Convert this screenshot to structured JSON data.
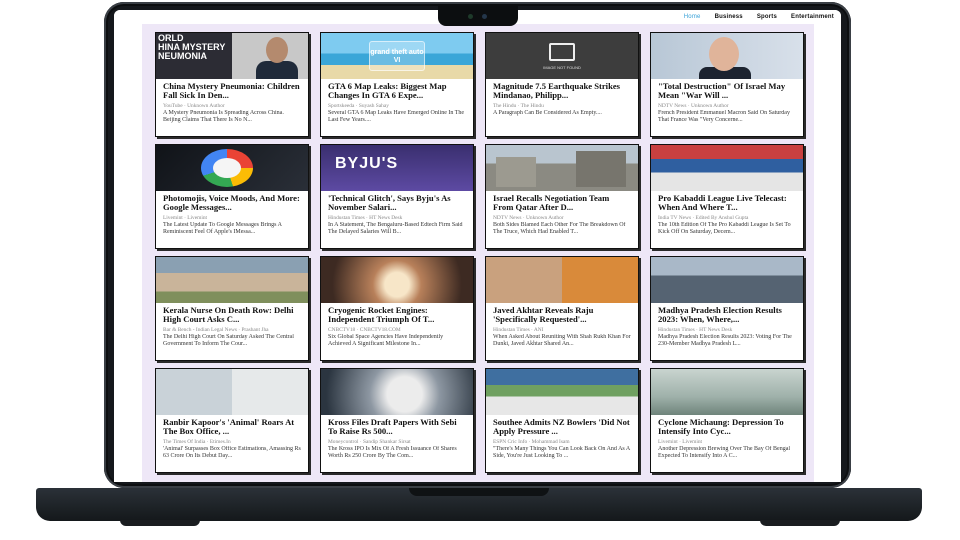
{
  "nav": {
    "items": [
      "Home",
      "Business",
      "Sports",
      "Entertainment"
    ]
  },
  "thumbs": {
    "card1_overlay": "ORLD\nHINA MYSTERY\nNEUMONIA",
    "card2_overlay": "grand theft auto VI",
    "card3_overlay": "IMAGE NOT FOUND",
    "card6_overlay": "BYJU'S"
  },
  "cards": [
    {
      "title": "China Mystery Pneumonia: Children Fall Sick In Den...",
      "meta": "YouTube · Unknown Author",
      "desc": "A Mystery Pneumonia Is Spreading Across China. Beijing Claims That There Is No N..."
    },
    {
      "title": "GTA 6 Map Leaks: Biggest Map Changes In GTA 6 Expe...",
      "meta": "Sportskeeda · Suyash Sahay",
      "desc": "Several GTA 6 Map Leaks Have Emerged Online In The Last Few Years...."
    },
    {
      "title": "Magnitude 7.5 Earthquake Strikes Mindanao, Philipp...",
      "meta": "The Hindu · The Hindu",
      "desc": "A Paragraph Can Be Considered As Empty...."
    },
    {
      "title": "\"Total Destruction\" Of Israel May Mean \"War Will ...",
      "meta": "NDTV News · Unknown Author",
      "desc": "French President Emmanuel Macron Said On Saturday That France Was \"Very Concerne..."
    },
    {
      "title": "Photomojis, Voice Moods, And More: Google Messages...",
      "meta": "Livemint · Livemint",
      "desc": "The Latest Update To Google Messages Brings A Reminiscent Feel Of Apple's IMessa..."
    },
    {
      "title": "'Technical Glitch', Says Byju's As November Salari...",
      "meta": "Hindustan Times · HT News Desk",
      "desc": "In A Statement, The Bengaluru-Based Edtech Firm Said The Delayed Salaries Will B..."
    },
    {
      "title": "Israel Recalls Negotiation Team From Qatar After D...",
      "meta": "NDTV News · Unknown Author",
      "desc": "Both Sides Blamed Each Other For The Breakdown Of The Truce, Which Had Enabled T..."
    },
    {
      "title": "Pro Kabaddi League Live Telecast: When And Where T...",
      "meta": "India TV News · Edited By Anshul Gupta",
      "desc": "The 10th Edition Of The Pro Kabaddi League Is Set To Kick Off On Saturday, Decem..."
    },
    {
      "title": "Kerala Nurse On Death Row: Delhi High Court Asks C...",
      "meta": "Bar & Bench - Indian Legal News · Prashant Jha",
      "desc": "The Delhi High Court On Saturday Asked The Central Government To Inform The Cour..."
    },
    {
      "title": "Cryogenic Rocket Engines: Independent Triumph Of T...",
      "meta": "CNBCTV18 · CNBCTV18.COM",
      "desc": "Six Global Space Agencies Have Independently Achieved A Significant Milestone In..."
    },
    {
      "title": "Javed Akhtar Reveals Raju 'Specifically Requested'...",
      "meta": "Hindustan Times · ANI",
      "desc": "When Asked About Reuniting With Shah Rukh Khan For Dunki, Javed Akhtar Shared An..."
    },
    {
      "title": "Madhya Pradesh Election Results 2023: When, Where,...",
      "meta": "Hindustan Times · HT News Desk",
      "desc": "Madhya Pradesh Election Results 2023: Voting For The 230-Member Madhya Pradesh L..."
    },
    {
      "title": "Ranbir Kapoor's 'Animal' Roars At The Box Office, ...",
      "meta": "The Times Of India · Etimes.In",
      "desc": "'Animal' Surpasses Box Office Estimations, Amassing Rs 63 Crore On Its Debut Day..."
    },
    {
      "title": "Kross Files Draft Papers With Sebi To Raise Rs 500...",
      "meta": "Moneycontrol · Sandip Shankar Sirsat",
      "desc": "The Kross IPO Is Mix Of A Fresh Issuance Of Shares Worth Rs 250 Crore By The Com..."
    },
    {
      "title": "Southee Admits NZ Bowlers 'Did Not Apply Pressure ...",
      "meta": "ESPN Cric Info · Mohammad Isam",
      "desc": "\"There's Many Things You Can Look Back On And As A Side, You're Just Looking To ..."
    },
    {
      "title": "Cyclone Michaung: Depression To Intensify Into Cyc...",
      "meta": "Livemint · Livemint",
      "desc": "Another Depression Brewing Over The Bay Of Bengal Expected To Intensify Into A C..."
    }
  ]
}
